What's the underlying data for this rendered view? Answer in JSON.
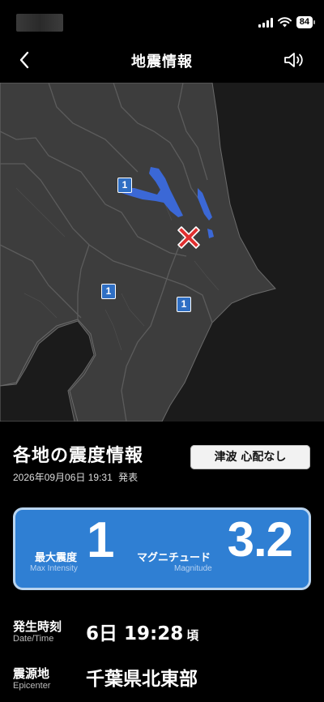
{
  "status": {
    "battery": "84"
  },
  "nav": {
    "title": "地震情報",
    "back_icon": "chevron-left-icon",
    "sound_icon": "speaker-icon"
  },
  "map": {
    "epicenter_icon": "epicenter-cross-icon",
    "intensity_badges": [
      "1",
      "1",
      "1"
    ],
    "colors": {
      "land": "#3d3d3d",
      "sea": "#1b1b1b",
      "lake": "#3b68d6",
      "badge": "#2f6fc4",
      "epicenter": "#e03030"
    }
  },
  "info": {
    "title": "各地の震度情報",
    "announce_time": "2026年09月06日 19:31",
    "announce_suffix": "発表",
    "tsunami": "津波 心配なし"
  },
  "card": {
    "max_intensity_label": "最大震度",
    "max_intensity_sub": "Max Intensity",
    "max_intensity": "1",
    "magnitude_label": "マグニチュード",
    "magnitude_sub": "Magnitude",
    "magnitude": "3.2",
    "color": "#2f7fd3"
  },
  "details": {
    "time_label": "発生時刻",
    "time_sub": "Date/Time",
    "time_value": "6日 19:28",
    "time_suffix": "頃",
    "epicenter_label": "震源地",
    "epicenter_sub": "Epicenter",
    "epicenter_value": "千葉県北東部"
  }
}
